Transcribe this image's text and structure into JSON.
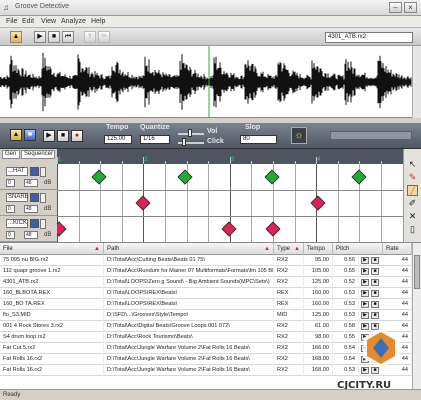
{
  "window": {
    "title": "Groove Detective",
    "minimize": "–",
    "close": "×"
  },
  "menu": {
    "items": [
      "File",
      "Edit",
      "View",
      "Analyze",
      "Help"
    ]
  },
  "wave_toolbar": {
    "file": "4301_ATB.rx2",
    "play": "▶",
    "stop": "■",
    "rewind": "⏮",
    "open": "📂"
  },
  "controls": {
    "tempo_label": "Tempo",
    "tempo_value": "125.00",
    "quantize_label": "Quantize",
    "quantize_value": "1/16",
    "vol_label": "Vol",
    "click_label": "Click",
    "slop_label": "Slop",
    "slop_value": "80"
  },
  "sequencer": {
    "header_cells": [
      "Gen",
      "Sequencer"
    ],
    "ruler_numbers": [
      "1",
      "2",
      "3",
      "4"
    ],
    "tracks": [
      {
        "name": "...HAT",
        "vol": "0",
        "pan": "48",
        "db": "dB",
        "color": "#22aa33"
      },
      {
        "name": "SNARE",
        "vol": "0",
        "pan": "48",
        "db": "dB",
        "color": "#dd2255"
      },
      {
        "name": "...KICK",
        "vol": "0",
        "pan": "48",
        "db": "dB",
        "color": "#dd2255"
      }
    ]
  },
  "table": {
    "columns": [
      "File",
      "Path",
      "Type",
      "Tempo",
      "Pitch",
      "Rate"
    ],
    "rows": [
      [
        "75 095 nu BIG.rx2",
        "D:\\Total\\Acc\\Cutting Beats\\Beats 01 75\\",
        "RX2",
        "95.00",
        "0.56",
        "44"
      ],
      [
        "112 quapr groove 1.rx2",
        "D:\\Total\\Acc\\Rundum for Mainer 07 Multiformats\\Formats\\fm 105 BPM\\",
        "RX2",
        "105.00",
        "0.55",
        "44"
      ],
      [
        "4301_ATB.rx2",
        "D:\\Total\\LOOPS\\Zero g Sound\\ - Big Ambient Sounds(MPC\\Sets\\)",
        "RX2",
        "125.00",
        "0.52",
        "44"
      ],
      [
        "160_BLBOTA.REX",
        "D:\\Total\\LOOPS\\REX\\Beats\\",
        "REX",
        "160.00",
        "0.53",
        "44"
      ],
      [
        "160_BO TA.REX",
        "D:\\Total\\LOOPS\\REX\\Beats\\",
        "REX",
        "160.00",
        "0.53",
        "44"
      ],
      [
        "flo_S3.MID",
        "D:\\SFD\\...\\Grooves\\Style\\Tempo\\",
        "MID",
        "125.00",
        "0.53",
        "44"
      ],
      [
        "001 4 Rock Stores 3.rx2",
        "D:\\Total\\Acc\\Digital Beats\\Groove Loops 001 072\\",
        "RX2",
        "61.00",
        "0.58",
        "44"
      ],
      [
        "S4 drum loop.rx2",
        "D:\\Total\\Acc\\Rock Tourismo\\Beats\\",
        "RX2",
        "98.00",
        "0.55",
        "44"
      ],
      [
        "Fat Cut 5.rx2",
        "D:\\Total\\Acc\\Jungle Warfare Volume 2\\Fat Rolls 16 Beats\\",
        "RX2",
        "166.00",
        "0.54",
        "44"
      ],
      [
        "Fat Rolls 16.rx2",
        "D:\\Total\\Acc\\Jungle Warfare Volume 2\\Fat Rolls 16 Beats\\",
        "RX2",
        "168.00",
        "0.54",
        "44"
      ],
      [
        "Fat Rolls 16.rx2",
        "D:\\Total\\Acc\\Jungle Warfare Volume 2\\Fat Rolls 16 Beats\\",
        "RX2",
        "168.00",
        "0.53",
        "44"
      ]
    ],
    "row_play": "▶",
    "row_stop": "■"
  },
  "statusbar": {
    "text": "Ready"
  },
  "watermark": {
    "text": "CJCITY.RU"
  }
}
